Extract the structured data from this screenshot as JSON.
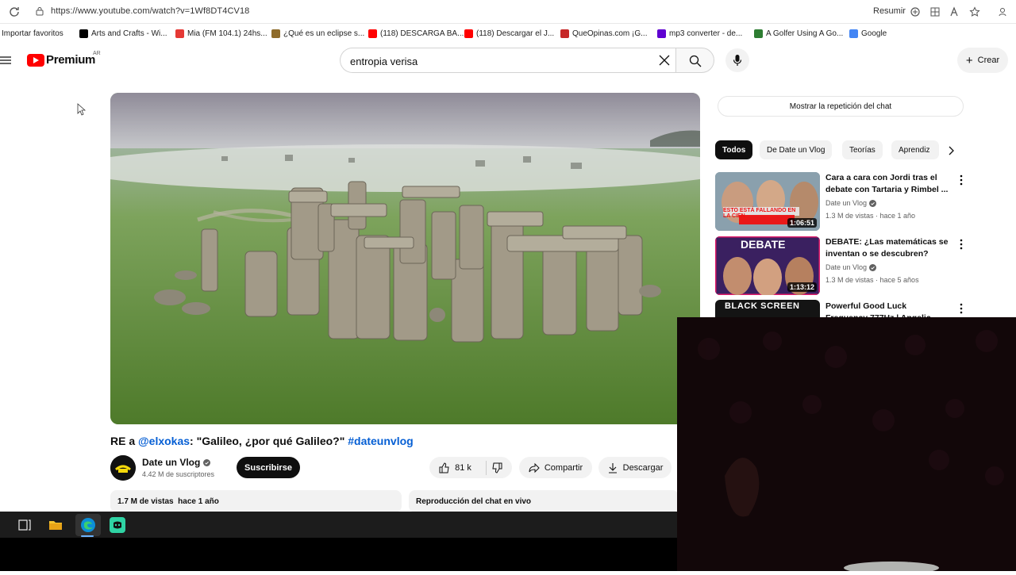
{
  "browser": {
    "url": "https://www.youtube.com/watch?v=1Wf8DT4CV18",
    "resumir_label": "Resumir"
  },
  "bookmarks": [
    {
      "label": "Importar favoritos",
      "icon": "import-icon",
      "color": "#ffffff"
    },
    {
      "label": "Arts and Crafts - Wi...",
      "icon": "wikipedia-icon",
      "color": "#000000"
    },
    {
      "label": "Mia (FM 104.1) 24hs...",
      "icon": "radio-icon",
      "color": "#e53935"
    },
    {
      "label": "¿Qué es un eclipse s...",
      "icon": "site-icon",
      "color": "#8e6b2a"
    },
    {
      "label": "(118) DESCARGA BA...",
      "icon": "youtube-icon",
      "color": "#ff0000"
    },
    {
      "label": "(118) Descargar el J...",
      "icon": "youtube-icon",
      "color": "#ff0000"
    },
    {
      "label": "QueOpinas.com ¡G...",
      "icon": "queopinas-icon",
      "color": "#c62828"
    },
    {
      "label": "mp3 converter - de...",
      "icon": "yahoo-icon",
      "color": "#5f01d1"
    },
    {
      "label": "A Golfer Using A Go...",
      "icon": "site-icon",
      "color": "#2e7d32"
    },
    {
      "label": "Google",
      "icon": "google-icon",
      "color": "#4285f4"
    }
  ],
  "header": {
    "brand": "Premium",
    "region": "AR",
    "search_value": "entropia verisa",
    "create_label": "Crear"
  },
  "video": {
    "title_prefix": "RE a ",
    "title_mention": "@elxokas",
    "title_quote": ": \"Galileo, ¿por qué Galileo?\" ",
    "title_hashtag": "#dateunvlog",
    "channel": "Date un Vlog",
    "subscribers": "4.42 M de suscriptores",
    "subscribe_label": "Suscribirse",
    "likes": "81 k",
    "share_label": "Compartir",
    "download_label": "Descargar",
    "views": "1.7 M de vistas",
    "age": "hace 1 año",
    "chat_replay": "Reproducción del chat en vivo"
  },
  "sidebar": {
    "chat_button": "Mostrar la repetición del chat",
    "chips": [
      "Todos",
      "De Date un Vlog",
      "Teorías",
      "Aprendiz"
    ],
    "recommendations": [
      {
        "title": "Cara a cara con Jordi tras el debate con Tartaria y Rimbel ...",
        "channel": "Date un Vlog",
        "meta": "1.3 M de vistas · hace 1 año",
        "duration": "1:06:51",
        "thumb_text": "ESTO ESTÁ FALLANDO EN LA CIEN"
      },
      {
        "title": "DEBATE: ¿Las matemáticas se inventan o se descubren?",
        "channel": "Date un Vlog",
        "meta": "1.3 M de vistas · hace 5 años",
        "duration": "1:13:12",
        "thumb_text": "DEBATE"
      },
      {
        "title": "Powerful Good Luck Frequency 777Hz | Angelic Assistance",
        "channel": "",
        "meta": "",
        "duration": "",
        "thumb_text": "BLACK SCREEN"
      }
    ]
  },
  "colors": {
    "youtube_red": "#ff0000",
    "link_blue": "#065fd4",
    "chip_bg": "#f2f2f2"
  }
}
